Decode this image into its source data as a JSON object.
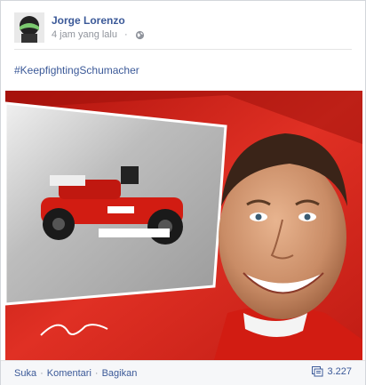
{
  "post": {
    "author": "Jorge Lorenzo",
    "timestamp": "4 jam yang lalu",
    "privacy_icon": "globe-icon",
    "text": "#KeepfightingSchumacher"
  },
  "footer": {
    "like_label": "Suka",
    "comment_label": "Komentari",
    "share_label": "Bagikan",
    "separator": "·",
    "share_count": "3.227"
  },
  "colors": {
    "link": "#3b5998",
    "meta": "#90949c",
    "photo_red": "#d0281e"
  }
}
